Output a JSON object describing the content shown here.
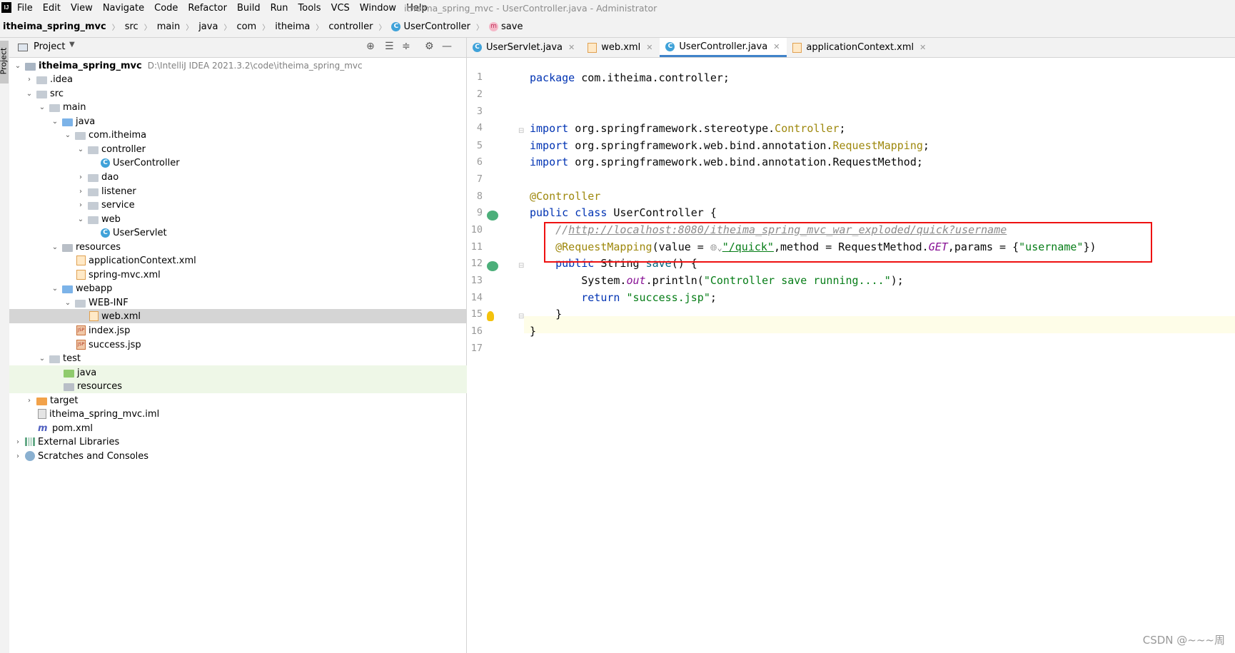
{
  "menubar": {
    "logo": "IJ",
    "items": [
      "File",
      "Edit",
      "View",
      "Navigate",
      "Code",
      "Refactor",
      "Build",
      "Run",
      "Tools",
      "VCS",
      "Window",
      "Help"
    ],
    "window_title": "itheima_spring_mvc - UserController.java - Administrator"
  },
  "breadcrumb": [
    "itheima_spring_mvc",
    "src",
    "main",
    "java",
    "com",
    "itheima",
    "controller",
    "UserController",
    "save"
  ],
  "project_panel": {
    "title": "Project",
    "tree": [
      {
        "label": "itheima_spring_mvc",
        "hint": "D:\\IntelliJ IDEA 2021.3.2\\code\\itheima_spring_mvc",
        "icon": "project-folder"
      },
      {
        "label": ".idea",
        "icon": "folder"
      },
      {
        "label": "src",
        "icon": "folder"
      },
      {
        "label": "main",
        "icon": "folder"
      },
      {
        "label": "java",
        "icon": "source-folder"
      },
      {
        "label": "com.itheima",
        "icon": "package"
      },
      {
        "label": "controller",
        "icon": "package"
      },
      {
        "label": "UserController",
        "icon": "class"
      },
      {
        "label": "dao",
        "icon": "package"
      },
      {
        "label": "listener",
        "icon": "package"
      },
      {
        "label": "service",
        "icon": "package"
      },
      {
        "label": "web",
        "icon": "package"
      },
      {
        "label": "UserServlet",
        "icon": "class"
      },
      {
        "label": "resources",
        "icon": "resources-folder"
      },
      {
        "label": "applicationContext.xml",
        "icon": "xml"
      },
      {
        "label": "spring-mvc.xml",
        "icon": "xml"
      },
      {
        "label": "webapp",
        "icon": "web-folder"
      },
      {
        "label": "WEB-INF",
        "icon": "folder"
      },
      {
        "label": "web.xml",
        "icon": "xml"
      },
      {
        "label": "index.jsp",
        "icon": "jsp"
      },
      {
        "label": "success.jsp",
        "icon": "jsp"
      },
      {
        "label": "test",
        "icon": "folder"
      },
      {
        "label": "java",
        "icon": "test-folder"
      },
      {
        "label": "resources",
        "icon": "resources-folder"
      },
      {
        "label": "target",
        "icon": "excluded-folder"
      },
      {
        "label": "itheima_spring_mvc.iml",
        "icon": "iml"
      },
      {
        "label": "pom.xml",
        "icon": "maven"
      },
      {
        "label": "External Libraries",
        "icon": "library"
      },
      {
        "label": "Scratches and Consoles",
        "icon": "scratch"
      }
    ]
  },
  "editor": {
    "tabs": [
      {
        "label": "UserServlet.java",
        "icon": "class",
        "active": false
      },
      {
        "label": "web.xml",
        "icon": "xml",
        "active": false
      },
      {
        "label": "UserController.java",
        "icon": "class",
        "active": true
      },
      {
        "label": "applicationContext.xml",
        "icon": "xml",
        "active": false
      }
    ],
    "line_numbers": [
      "1",
      "2",
      "3",
      "4",
      "5",
      "6",
      "7",
      "8",
      "9",
      "10",
      "11",
      "12",
      "13",
      "14",
      "15",
      "16",
      "17"
    ],
    "code": {
      "l1_kw": "package",
      "l1_rest": " com.itheima.controller;",
      "l4_kw": "import",
      "l4_a": " org.springframework.stereotype.",
      "l4_b": "Controller",
      "l4_c": ";",
      "l5_kw": "import",
      "l5_a": " org.springframework.web.bind.annotation.",
      "l5_b": "RequestMapping",
      "l5_c": ";",
      "l6_kw": "import",
      "l6_a": " org.springframework.web.bind.annotation.RequestMethod;",
      "l8_ann": "@Controller",
      "l9_kw": "public class",
      "l9_rest": " UserController {",
      "l10_cm": "    //",
      "l10_link": "http://localhost:8080/itheima_spring_mvc_war_exploded/quick?username",
      "l11_ann": "    @RequestMapping",
      "l11_a": "(value = ",
      "l11_globe": "🌐︎⌄",
      "l11_str": "\"/quick\"",
      "l11_b": ",method = RequestMethod.",
      "l11_field": "GET",
      "l11_c": ",params = {",
      "l11_str2": "\"username\"",
      "l11_d": "})",
      "l12_kw": "    public",
      "l12_a": " String ",
      "l12_meth": "save",
      "l12_b": "() {",
      "l13_a": "        System.",
      "l13_field": "out",
      "l13_b": ".println(",
      "l13_str": "\"Controller save running....\"",
      "l13_c": ");",
      "l14_kw": "        return",
      "l14_a": " ",
      "l14_str": "\"success.jsp\"",
      "l14_c": ";",
      "l15": "    }",
      "l16": "}"
    }
  },
  "watermark": "CSDN @~~~周"
}
